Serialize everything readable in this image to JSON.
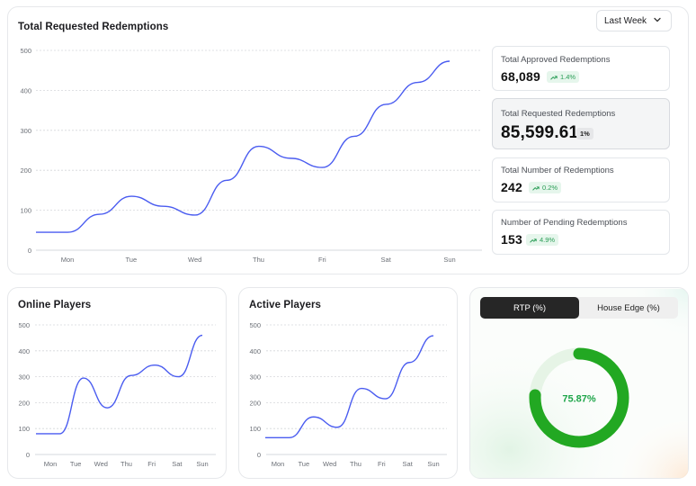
{
  "main_card": {
    "title": "Total Requested Redemptions",
    "period_select": {
      "value": "Last Week"
    }
  },
  "stats": [
    {
      "label": "Total Approved Redemptions",
      "value": "68,089",
      "change": "1.4%",
      "trend": "up"
    },
    {
      "label": "Total Requested Redemptions",
      "value": "85,599.61",
      "change": "1%",
      "trend": "flat"
    },
    {
      "label": "Total Number of Redemptions",
      "value": "242",
      "change": "0.2%",
      "trend": "up"
    },
    {
      "label": "Number of Pending Redemptions",
      "value": "153",
      "change": "4.9%",
      "trend": "up"
    }
  ],
  "online_card": {
    "title": "Online Players"
  },
  "active_card": {
    "title": "Active Players"
  },
  "rtp_card": {
    "tabs": [
      "RTP (%)",
      "House Edge (%)"
    ],
    "selected_tab": "RTP (%)",
    "value_label": "75.87%",
    "value": 75.87
  },
  "colors": {
    "line": "#4a5cf0",
    "gauge": "#22a822",
    "gauge_track": "#e6f4e6",
    "gauge_text": "#1fa64a"
  },
  "chart_data": [
    {
      "type": "line",
      "title": "Total Requested Redemptions",
      "categories": [
        "Mon",
        "Tue",
        "Wed",
        "Thu",
        "Fri",
        "Sat",
        "Sun"
      ],
      "x": [
        "",
        "Mon",
        "",
        "Tue",
        "",
        "Wed",
        "",
        "Thu",
        "",
        "Fri",
        "",
        "Sat",
        "",
        "Sun"
      ],
      "values": [
        45,
        45,
        90,
        135,
        110,
        88,
        175,
        260,
        230,
        207,
        285,
        365,
        420,
        473
      ],
      "ylim": [
        0,
        500
      ],
      "yticks": [
        0,
        100,
        200,
        300,
        400,
        500
      ],
      "grid": true
    },
    {
      "type": "line",
      "title": "Online Players",
      "categories": [
        "Mon",
        "Tue",
        "Wed",
        "Thu",
        "Fri",
        "Sat",
        "Sun"
      ],
      "values": [
        80,
        80,
        295,
        180,
        305,
        345,
        300,
        460
      ],
      "ylim": [
        0,
        500
      ],
      "yticks": [
        0,
        100,
        200,
        300,
        400,
        500
      ],
      "grid": true
    },
    {
      "type": "line",
      "title": "Active Players",
      "categories": [
        "Mon",
        "Tue",
        "Wed",
        "Thu",
        "Fri",
        "Sat",
        "Sun"
      ],
      "values": [
        65,
        65,
        145,
        105,
        255,
        215,
        355,
        458
      ],
      "ylim": [
        0,
        500
      ],
      "yticks": [
        0,
        100,
        200,
        300,
        400,
        500
      ],
      "grid": true
    }
  ]
}
